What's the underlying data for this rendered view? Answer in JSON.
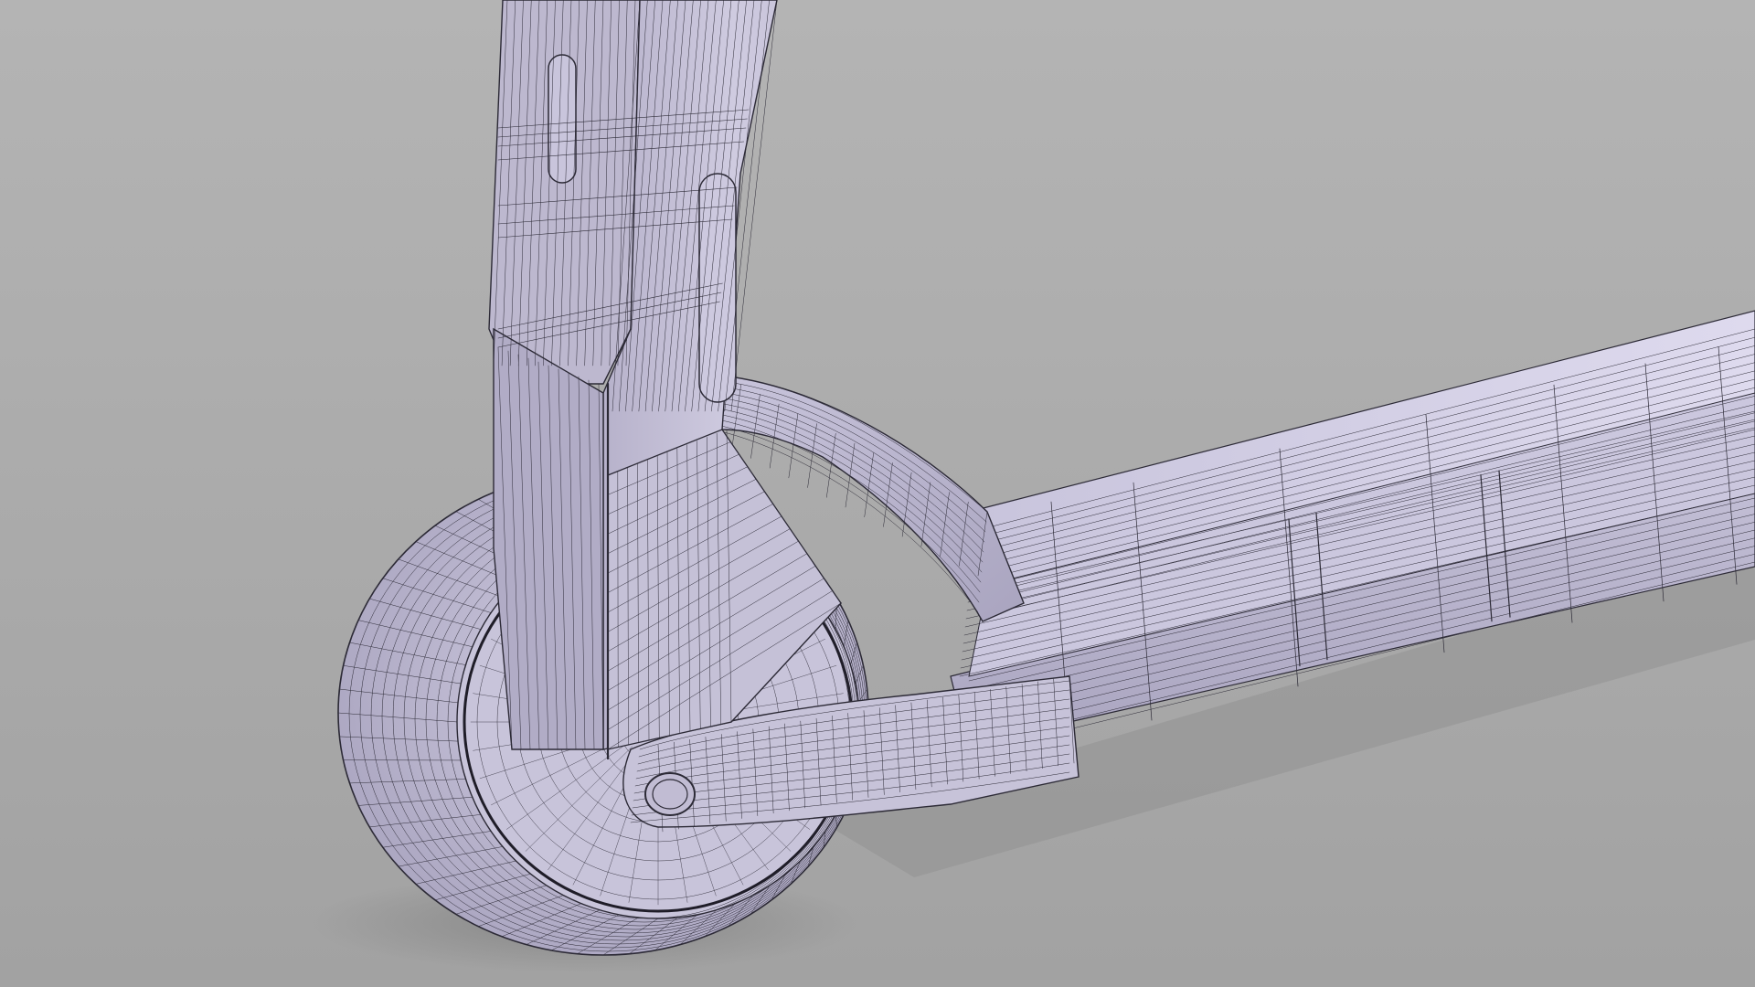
{
  "scene": {
    "subject": "scooter-front-wireframe",
    "colors": {
      "background_light": "#b4b4b4",
      "background_dark": "#a2a2a2",
      "mesh_light": "#d9d5ea",
      "mesh_mid": "#bcb7d0",
      "mesh_dark": "#8f8aa5",
      "wire": "#2c2a36",
      "shadow": "#8b8b8b"
    },
    "icons": []
  }
}
